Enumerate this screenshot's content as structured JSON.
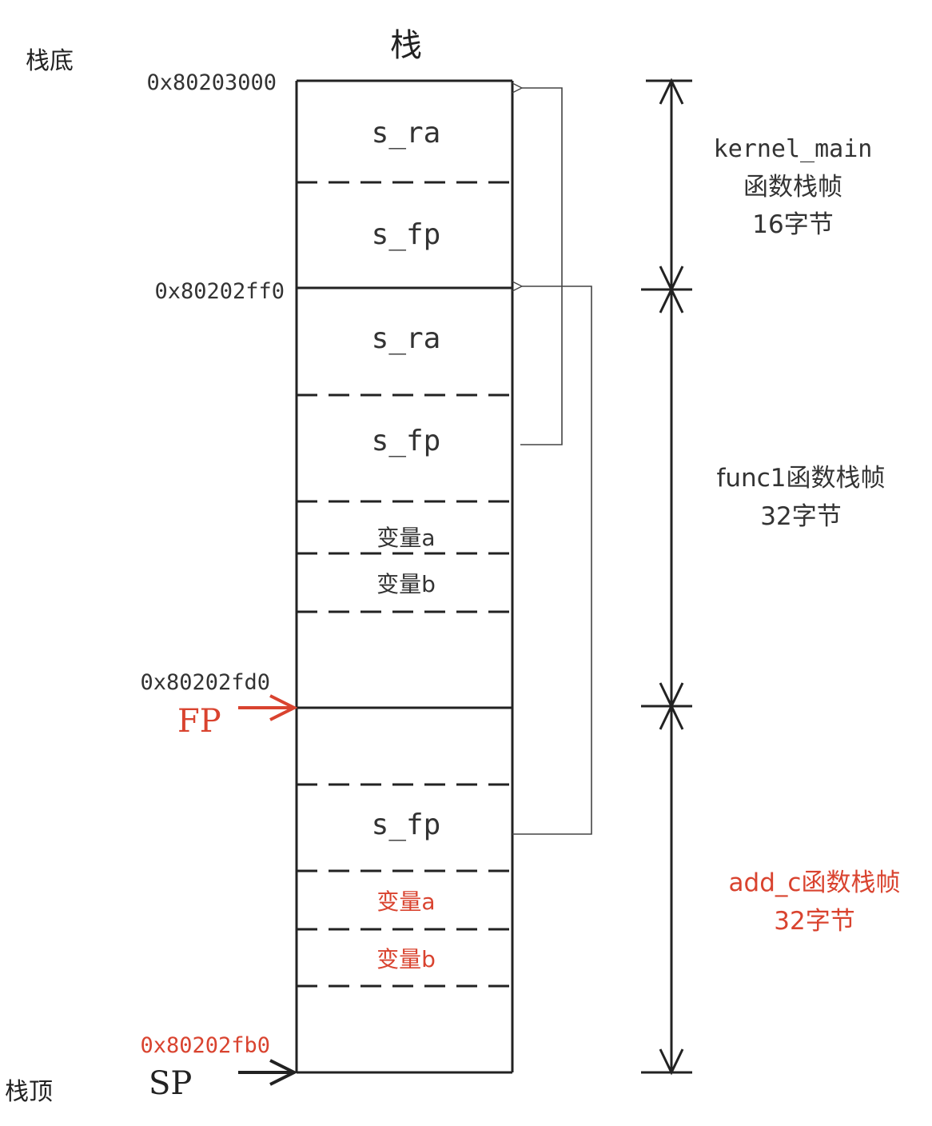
{
  "title": "栈",
  "bottom_label": "栈底",
  "top_label": "栈顶",
  "addresses": {
    "a0": "0x80203000",
    "a1": "0x80202ff0",
    "a2": "0x80202fd0",
    "a3": "0x80202fb0"
  },
  "pointers": {
    "fp": "FP",
    "sp": "SP"
  },
  "cells": {
    "kernel_ra": "s_ra",
    "kernel_fp": "s_fp",
    "func1_ra": "s_ra",
    "func1_fp": "s_fp",
    "func1_var_a": "变量a",
    "func1_var_b": "变量b",
    "addc_fp": "s_fp",
    "addc_var_a": "变量a",
    "addc_var_b": "变量b"
  },
  "frames": {
    "kernel_main": {
      "name": "kernel_main",
      "line2": "函数栈帧",
      "size": "16字节"
    },
    "func1": {
      "line1": "func1函数栈帧",
      "size": "32字节"
    },
    "add_c": {
      "line1": "add_c函数栈帧",
      "size": "32字节"
    }
  },
  "colors": {
    "ink": "#222222",
    "accent_red": "#d9432f",
    "address_red": "#d9432f",
    "frame_text": "#333333"
  }
}
